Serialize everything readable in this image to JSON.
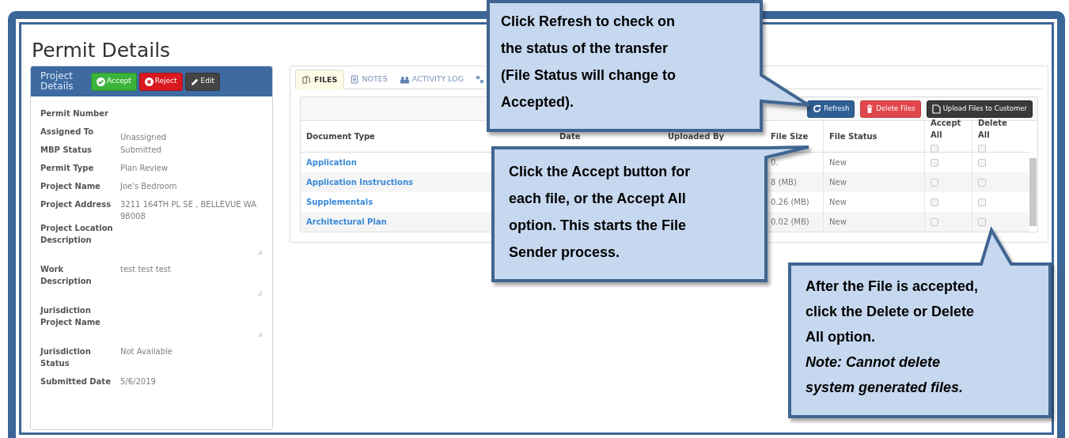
{
  "page_title": "Permit Details",
  "project_panel": {
    "title": "Project Details",
    "buttons": [
      {
        "kind": "accept",
        "label": "Accept"
      },
      {
        "kind": "reject",
        "label": "Reject"
      },
      {
        "kind": "edit",
        "label": "Edit"
      }
    ],
    "fields": [
      {
        "kind": "text",
        "label": "Permit Number"
      },
      {
        "kind": "text",
        "label": "Assigned To",
        "value": "Unassigned"
      },
      {
        "kind": "text",
        "label": "MBP Status",
        "value": "Submitted"
      },
      {
        "kind": "text",
        "label": "Permit Type",
        "value": "Plan Review"
      },
      {
        "kind": "text",
        "label": "Project Name",
        "value": "Joe's Bedroom"
      },
      {
        "kind": "text",
        "label": "Project Address",
        "value": "3211 164TH PL SE , BELLEVUE WA 98008"
      },
      {
        "kind": "textarea",
        "label": "Project Location Description"
      },
      {
        "kind": "textarea",
        "label": "Work Description",
        "value": "test test test"
      },
      {
        "kind": "textarea",
        "label": "Jurisdiction Project Name"
      },
      {
        "kind": "text",
        "label": "Jurisdiction Status",
        "value": "Not Available"
      },
      {
        "kind": "text",
        "label": "Submitted Date",
        "value": "5/6/2019"
      }
    ]
  },
  "tabs": [
    {
      "kind": "files",
      "label": "FILES",
      "selected": true
    },
    {
      "kind": "notes",
      "label": "NOTES",
      "selected": false
    },
    {
      "kind": "activity",
      "label": "ACTIVITY LOG",
      "selected": false
    },
    {
      "kind": "other",
      "selected": false
    }
  ],
  "toolbar": [
    {
      "kind": "refresh",
      "label": "Refresh"
    },
    {
      "kind": "delete",
      "label": "Delete Files"
    },
    {
      "kind": "upload",
      "label": "Upload Files to Customer"
    }
  ],
  "table": {
    "columns": [
      "Document Type",
      "Date",
      "Uploaded By",
      "File Size",
      "File Status",
      "Accept All",
      "Delete All"
    ],
    "accept_all_checked": false,
    "delete_all_checked": false,
    "rows": [
      {
        "document_type": "Application",
        "file_size": "0.",
        "file_status": "New",
        "accept": false,
        "delete": false
      },
      {
        "document_type": "Application Instructions",
        "file_size": "8 (MB)",
        "file_status": "New",
        "accept": false,
        "delete": false
      },
      {
        "document_type": "Supplementals",
        "file_size": "0.26 (MB)",
        "file_status": "New",
        "accept": false,
        "delete": false
      },
      {
        "document_type": "Architectural Plan",
        "file_size": "0.02 (MB)",
        "file_status": "New",
        "accept": false,
        "delete": false
      }
    ]
  },
  "callouts": [
    {
      "lines": [
        "Click Refresh to check on",
        "the status of the transfer",
        "(File Status will change to",
        "Accepted)."
      ]
    },
    {
      "lines": [
        "Click the Accept button for",
        "each file, or the Accept All",
        "option. This starts the File",
        "Sender process."
      ]
    },
    {
      "lines": [
        "After the File is accepted,",
        "click the Delete or Delete",
        "All option."
      ],
      "note": [
        "Note: Cannot delete",
        "system generated files."
      ]
    }
  ]
}
